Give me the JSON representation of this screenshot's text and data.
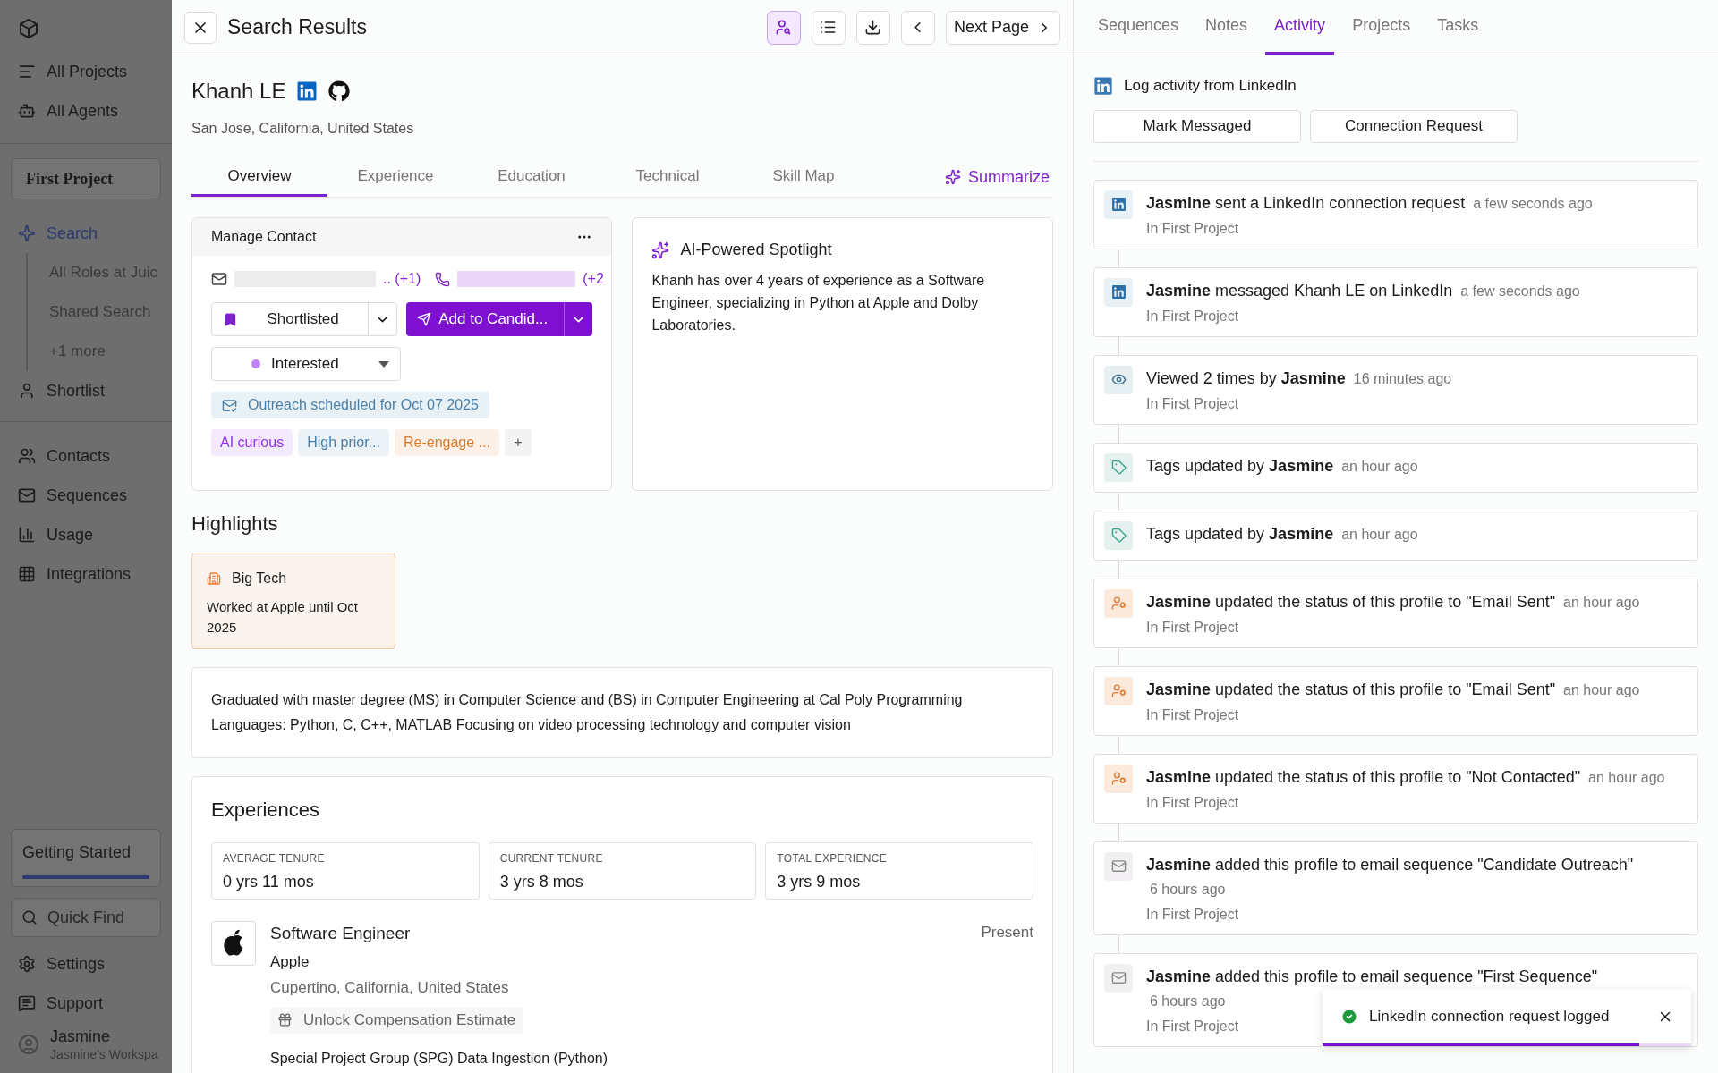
{
  "sidebar": {
    "nav": [
      {
        "label": "All Projects"
      },
      {
        "label": "All Agents"
      }
    ],
    "project": "First Project",
    "project_nav": [
      {
        "label": "Search",
        "selected": true,
        "children": [
          {
            "label": "All Roles at Juic"
          },
          {
            "label": "Shared Search"
          },
          {
            "label": "+1 more"
          }
        ]
      },
      {
        "label": "Shortlist",
        "selected": false
      }
    ],
    "tools": [
      {
        "label": "Contacts"
      },
      {
        "label": "Sequences"
      },
      {
        "label": "Usage"
      },
      {
        "label": "Integrations"
      }
    ],
    "getting_started": {
      "label": "Getting Started",
      "level": 1
    },
    "quick_find": {
      "placeholder": "Quick Find"
    },
    "footer": [
      {
        "label": "Settings"
      },
      {
        "label": "Support"
      }
    ],
    "user": {
      "name": "Jasmine",
      "workspace": "Jasmine's Workspa"
    }
  },
  "header": {
    "title": "Search Results",
    "toolbar_buttons": [
      {
        "selected": true
      },
      {
        "selected": false
      },
      {
        "selected": false
      },
      {
        "selected": false
      }
    ],
    "next_page": "Next Page"
  },
  "profile": {
    "name": "Khanh LE",
    "location": "San Jose, California, United States",
    "tabs": [
      {
        "label": "Overview",
        "selected": true
      },
      {
        "label": "Experience",
        "selected": false
      },
      {
        "label": "Education",
        "selected": false
      },
      {
        "label": "Technical",
        "selected": false
      },
      {
        "label": "Skill Map",
        "selected": false
      }
    ],
    "summarize": "Summarize"
  },
  "manage_contact": {
    "title": "Manage Contact",
    "email_more": ".. (+1)",
    "phone_more": "(+2",
    "status": "Shortlisted",
    "action": "Add to Candid...",
    "interest": "Interested",
    "outreach": "Outreach scheduled for Oct 07 2025",
    "tags": [
      {
        "label": "AI curious",
        "color": "#9333ea"
      },
      {
        "label": "High prior...",
        "color": "#4b7fa8"
      },
      {
        "label": "Re-engage ...",
        "color": "#d97a2b"
      }
    ],
    "add_tag": "+"
  },
  "spotlight": {
    "title": "AI-Powered Spotlight",
    "text": "Khanh has over 4 years of experience as a Software Engineer, specializing in Python at Apple and Dolby Laboratories."
  },
  "highlights": {
    "title": "Highlights",
    "cards": [
      {
        "title": "Big Tech",
        "text": "Worked at Apple until Oct 2025"
      }
    ]
  },
  "summary": "Graduated with master degree (MS) in Computer Science and (BS) in Computer Engineering at Cal Poly Programming Languages: Python, C, C++, MATLAB Focusing on video processing technology and computer vision",
  "experiences": {
    "title": "Experiences",
    "stats": [
      {
        "label": "AVERAGE TENURE",
        "value": "0 yrs 11 mos"
      },
      {
        "label": "CURRENT TENURE",
        "value": "3 yrs 8 mos"
      },
      {
        "label": "TOTAL EXPERIENCE",
        "value": "3 yrs 9 mos"
      }
    ],
    "jobs": [
      {
        "title": "Software Engineer",
        "company": "Apple",
        "location": "Cupertino, California, United States",
        "period": "Present",
        "unlock": "Unlock Compensation Estimate",
        "project": "Special Project Group (SPG) Data Ingestion (Python)"
      }
    ]
  },
  "right_panel": {
    "tabs": [
      {
        "label": "Sequences",
        "selected": false
      },
      {
        "label": "Notes",
        "selected": false
      },
      {
        "label": "Activity",
        "selected": true
      },
      {
        "label": "Projects",
        "selected": false
      },
      {
        "label": "Tasks",
        "selected": false
      }
    ],
    "log": {
      "label": "Log activity from LinkedIn",
      "buttons": [
        "Mark Messaged",
        "Connection Request"
      ]
    },
    "activity": [
      {
        "kind": "linkedin",
        "text": "**Jasmine** sent a LinkedIn connection request",
        "time": "a few seconds ago",
        "project": "In First Project"
      },
      {
        "kind": "linkedin",
        "text": "**Jasmine** messaged Khanh LE on LinkedIn",
        "time": "a few seconds ago",
        "project": "In First Project"
      },
      {
        "kind": "view",
        "text": "Viewed 2 times by **Jasmine**",
        "time": "16 minutes ago",
        "project": "In First Project"
      },
      {
        "kind": "tag",
        "text": "Tags updated by **Jasmine**",
        "time": "an hour ago"
      },
      {
        "kind": "tag",
        "text": "Tags updated by **Jasmine**",
        "time": "an hour ago"
      },
      {
        "kind": "status",
        "text": "**Jasmine** updated the status of this profile to \"Email Sent\"",
        "time": "an hour ago",
        "project": "In First Project"
      },
      {
        "kind": "status",
        "text": "**Jasmine** updated the status of this profile to \"Email Sent\"",
        "time": "an hour ago",
        "project": "In First Project"
      },
      {
        "kind": "status",
        "text": "**Jasmine** updated the status of this profile to \"Not Contacted\"",
        "time": "an hour ago",
        "project": "In First Project"
      },
      {
        "kind": "email",
        "text": "**Jasmine** added this profile to email sequence \"Candidate Outreach\"",
        "time": "6 hours ago",
        "project": "In First Project"
      },
      {
        "kind": "email",
        "text": "**Jasmine** added this profile to email sequence \"First Sequence\"",
        "time": "6 hours ago",
        "project": "In First Project"
      }
    ],
    "toast": {
      "message": "LinkedIn connection request logged",
      "level": 0.86
    }
  }
}
